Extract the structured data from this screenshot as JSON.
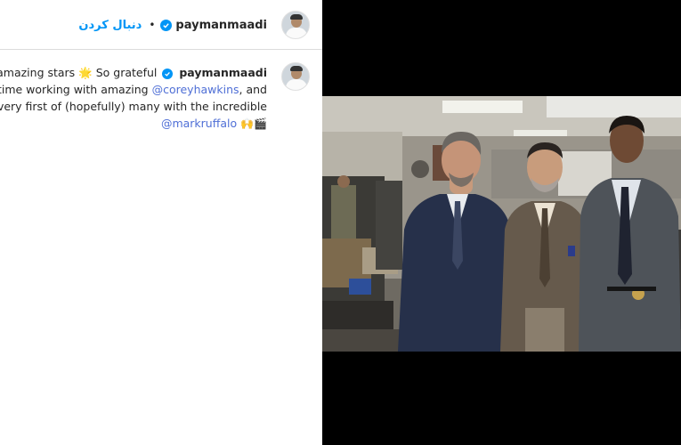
{
  "header": {
    "follow_label": "دنبال کردن",
    "separator": "•",
    "username": "paymanmaadi"
  },
  "caption": {
    "line1_text": "e two amazing stars 🌟 So grateful",
    "line1_user": "paymanmaadi",
    "line2_text": "ond time working with amazing",
    "line2_mention": "@coreyhawkins",
    "line2_end": ", and",
    "line3_text": "the very first of (hopefully) many with the incredible",
    "line4_mention": "@markruffalo",
    "line4_emoji": "🙌🎬"
  },
  "photo": {
    "description_icon": "photo-image"
  },
  "colors": {
    "accent": "#0095f6",
    "mention": "#4f6fd6",
    "text": "#262626",
    "background_right": "#000000"
  }
}
